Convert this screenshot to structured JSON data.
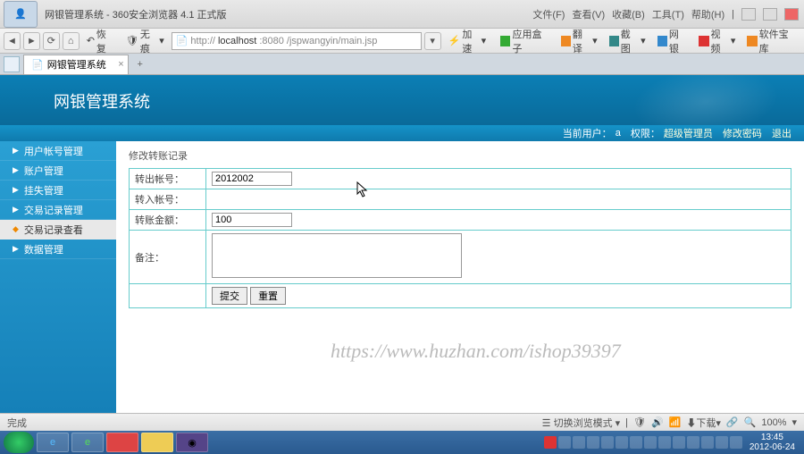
{
  "browser": {
    "title": "网银管理系统 - 360安全浏览器 4.1 正式版",
    "menus": [
      "文件(F)",
      "查看(V)",
      "收藏(B)",
      "工具(T)",
      "帮助(H)"
    ],
    "restore_label": "恢复",
    "proxy_label": "无痕",
    "url_prefix": "http://",
    "url_host": "localhost",
    "url_port": ":8080",
    "url_path": "/jspwangyin/main.jsp",
    "speed_label": "加速",
    "right_btns": [
      "应用盒子",
      "翻译",
      "截图",
      "网银",
      "视频",
      "软件宝库"
    ],
    "tab_label": "网银管理系统"
  },
  "app": {
    "banner_title": "网银管理系统",
    "userbar_prefix": "当前用户：",
    "userbar_user": "a",
    "userbar_role_label": "权限：",
    "userbar_role": "超级管理员",
    "userbar_changepw": "修改密码",
    "userbar_logout": "退出"
  },
  "sidebar": {
    "items": [
      {
        "label": "用户帐号管理"
      },
      {
        "label": "账户管理"
      },
      {
        "label": "挂失管理"
      },
      {
        "label": "交易记录管理"
      },
      {
        "label": "交易记录查看"
      },
      {
        "label": "数据管理"
      }
    ]
  },
  "form": {
    "panel_title": "修改转账记录",
    "out_account_label": "转出帐号：",
    "out_account_value": "2012002",
    "in_account_label": "转入帐号：",
    "in_account_value": "",
    "amount_label": "转账金额：",
    "amount_value": "100",
    "remark_label": "备注：",
    "remark_value": "",
    "submit": "提交",
    "reset": "重置"
  },
  "watermark": "https://www.huzhan.com/ishop39397",
  "status": {
    "left": "完成",
    "switch_mode": "切换浏览模式",
    "download": "下载",
    "zoom": "100%"
  },
  "taskbar": {
    "time": "13:45",
    "date": "2012-06-24"
  }
}
